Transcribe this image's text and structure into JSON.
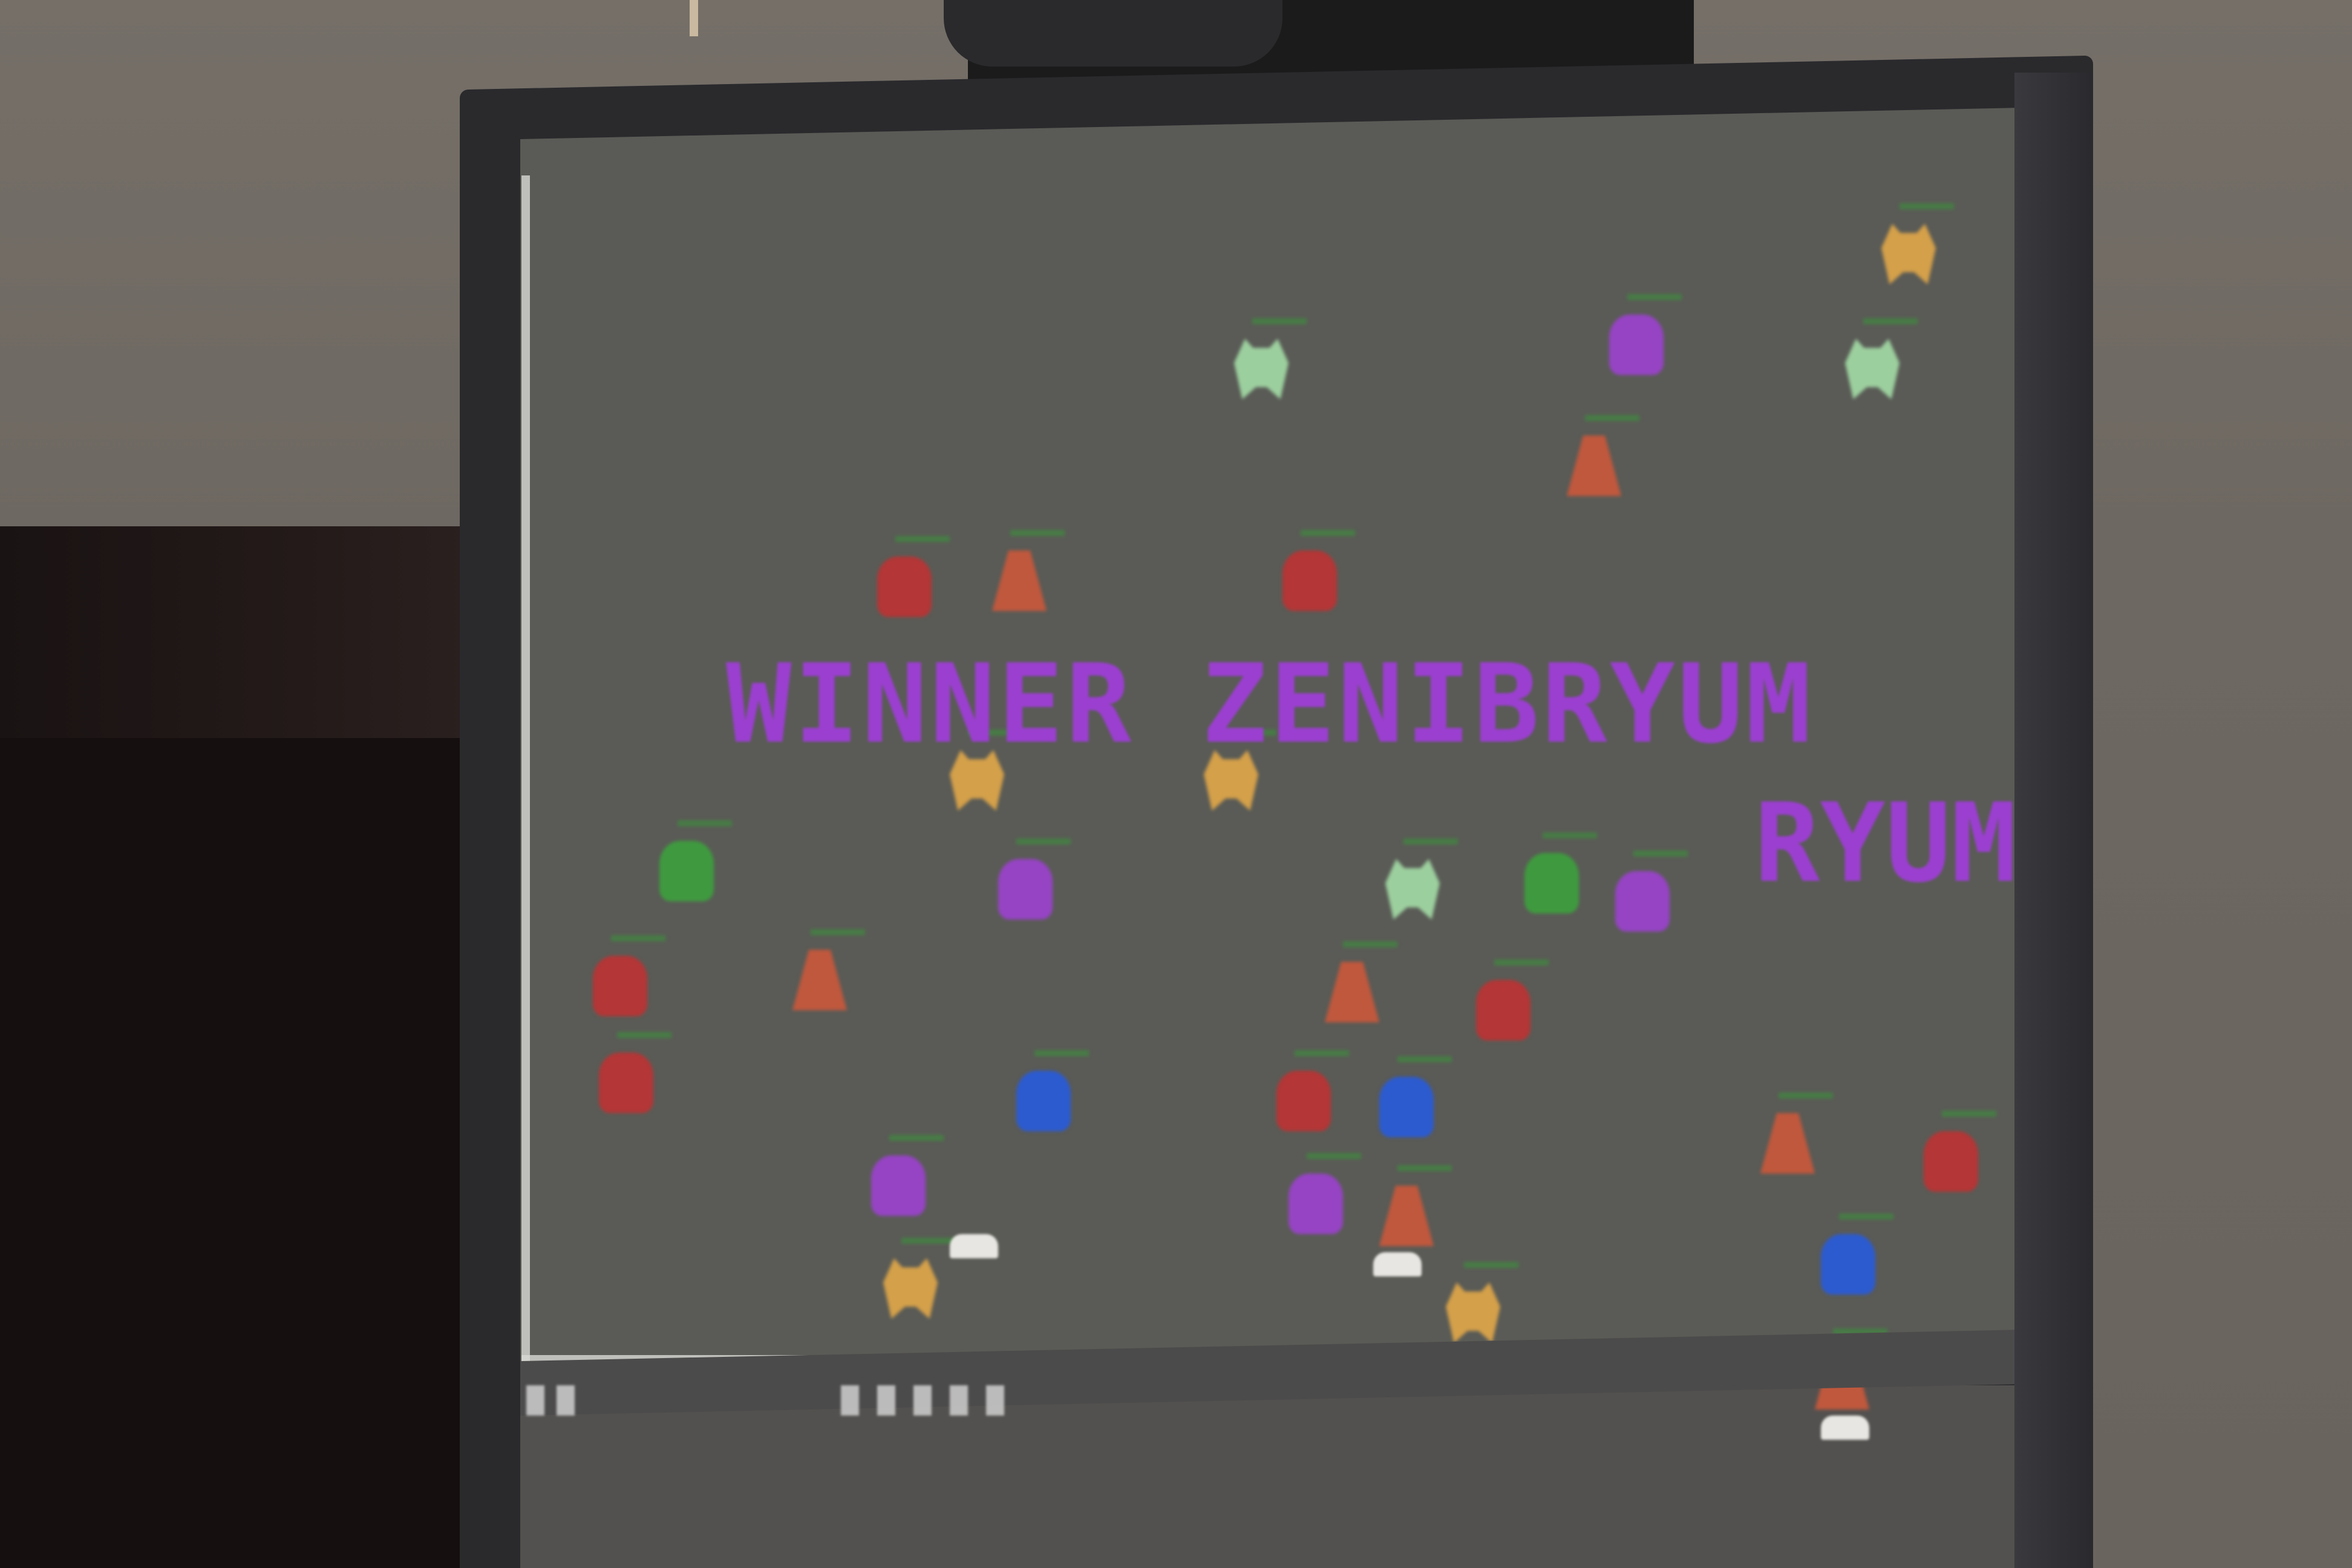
{
  "game": {
    "winner_text": "WINNER ZENIBRYUM",
    "winner_echo": "RYUM",
    "colors": {
      "background": "#5a5b56",
      "winner_text": "#9b3fd0",
      "tank": "#e8e6e2"
    }
  },
  "sprites": [
    {
      "shape": "bug",
      "color": "#9ccf9e"
    },
    {
      "shape": "blob",
      "color": "#9644c4"
    },
    {
      "shape": "bug",
      "color": "#d4a04a"
    },
    {
      "shape": "bug",
      "color": "#9ccf9e"
    },
    {
      "shape": "tri",
      "color": "#c0583d"
    },
    {
      "shape": "blob",
      "color": "#b43636"
    },
    {
      "shape": "tri",
      "color": "#c0583d"
    },
    {
      "shape": "blob",
      "color": "#b43636"
    },
    {
      "shape": "bug",
      "color": "#d4a04a"
    },
    {
      "shape": "bug",
      "color": "#d4a04a"
    },
    {
      "shape": "blob",
      "color": "#3f9a3f"
    },
    {
      "shape": "blob",
      "color": "#9644c4"
    },
    {
      "shape": "bug",
      "color": "#9ccf9e"
    },
    {
      "shape": "blob",
      "color": "#3f9a3f"
    },
    {
      "shape": "blob",
      "color": "#9644c4"
    },
    {
      "shape": "blob",
      "color": "#b43636"
    },
    {
      "shape": "tri",
      "color": "#c0583d"
    },
    {
      "shape": "tri",
      "color": "#c0583d"
    },
    {
      "shape": "blob",
      "color": "#b43636"
    },
    {
      "shape": "blob",
      "color": "#b43636"
    },
    {
      "shape": "blob",
      "color": "#2c5bd0"
    },
    {
      "shape": "blob",
      "color": "#b43636"
    },
    {
      "shape": "blob",
      "color": "#2c5bd0"
    },
    {
      "shape": "blob",
      "color": "#9644c4"
    },
    {
      "shape": "blob",
      "color": "#9644c4"
    },
    {
      "shape": "tri",
      "color": "#c0583d"
    },
    {
      "shape": "bug",
      "color": "#d4a04a"
    },
    {
      "shape": "bug",
      "color": "#d4a04a"
    },
    {
      "shape": "tri",
      "color": "#c0583d"
    },
    {
      "shape": "blob",
      "color": "#b43636"
    },
    {
      "shape": "blob",
      "color": "#2c5bd0"
    },
    {
      "shape": "tri",
      "color": "#c0583d"
    }
  ]
}
